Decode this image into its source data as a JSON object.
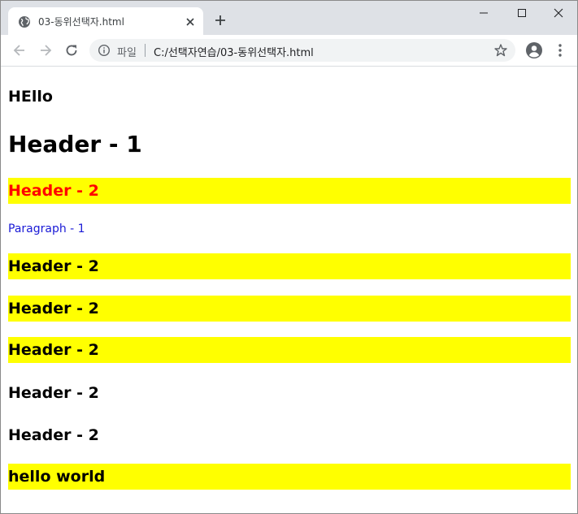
{
  "browser": {
    "tab_title": "03-동위선택자.html",
    "scheme_label": "파일",
    "url": "C:/선택자연습/03-동위선택자.html"
  },
  "page": {
    "blocks": [
      {
        "id": "hello",
        "text": "HEllo"
      },
      {
        "id": "h1",
        "text": "Header - 1"
      },
      {
        "id": "h2-red",
        "text": "Header - 2"
      },
      {
        "id": "p1",
        "text": "Paragraph - 1"
      },
      {
        "id": "h2-a",
        "text": "Header - 2"
      },
      {
        "id": "h2-b",
        "text": "Header - 2"
      },
      {
        "id": "h2-c",
        "text": "Header - 2"
      },
      {
        "id": "h2-d",
        "text": "Header - 2"
      },
      {
        "id": "h2-e",
        "text": "Header - 2"
      },
      {
        "id": "hw",
        "text": "hello world"
      }
    ]
  },
  "colors": {
    "highlight": "#ffff00",
    "red_text": "#ff0000",
    "paragraph_text": "#1a1ad6",
    "tabstrip": "#dee1e6"
  },
  "icons": [
    "globe-icon",
    "close-icon",
    "plus-icon",
    "minimize-icon",
    "maximize-icon",
    "window-close-icon",
    "back-arrow-icon",
    "forward-arrow-icon",
    "reload-icon",
    "info-icon",
    "star-icon",
    "profile-icon",
    "kebab-menu-icon"
  ]
}
